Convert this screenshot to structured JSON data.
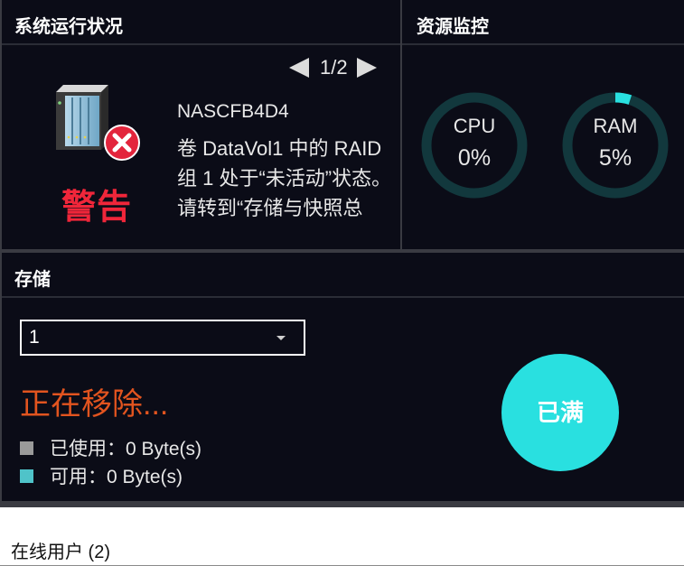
{
  "system_status": {
    "title": "系统运行状况",
    "status_label": "警告",
    "page_current": "1",
    "page_total": "2",
    "page_indicator": "1/2",
    "device_name": "NASCFB4D4",
    "message": "卷 DataVol1 中的 RAID 组 1 处于“未活动”状态。请转到“存储与快照总管”来修复"
  },
  "resource_monitor": {
    "title": "资源监控",
    "cpu": {
      "label": "CPU",
      "value_text": "0%",
      "value": 0
    },
    "ram": {
      "label": "RAM",
      "value_text": "5%",
      "value": 5
    }
  },
  "storage": {
    "title": "存储",
    "selected_volume": "1",
    "state_text": "正在移除...",
    "used": {
      "label": "已使用：0 Byte(s)",
      "color": "#9a9a9a"
    },
    "available": {
      "label": "可用：0 Byte(s)",
      "color": "#4fc3c9"
    },
    "capacity_status": "已满"
  },
  "online_users": {
    "title": "在线用户 (2)"
  },
  "colors": {
    "panel_bg": "#0b0c17",
    "warning_red": "#f0263a",
    "removing_orange": "#e2541f",
    "accent_cyan": "#29e0e0",
    "gauge_track": "#12383d"
  }
}
